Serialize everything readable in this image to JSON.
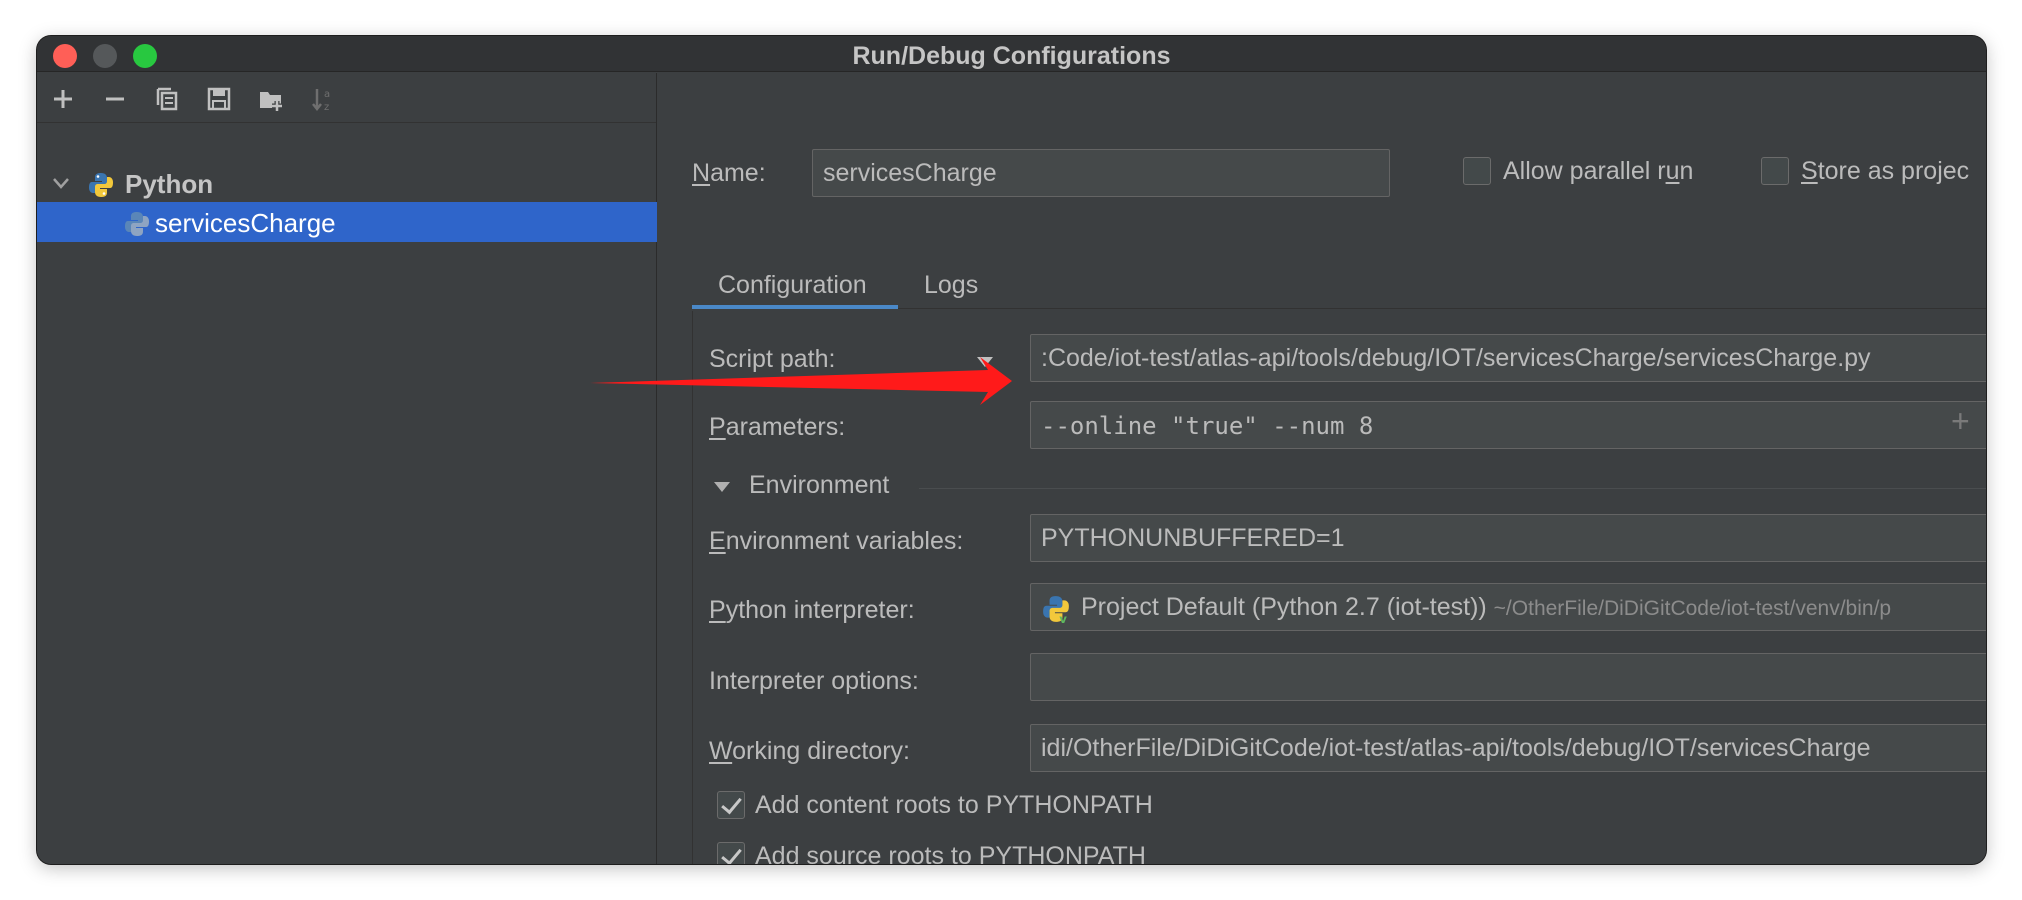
{
  "window": {
    "title": "Run/Debug Configurations"
  },
  "toolbar": {
    "icons": [
      "add-icon",
      "remove-icon",
      "copy-icon",
      "save-icon",
      "new-folder-icon",
      "sort-icon"
    ]
  },
  "tree": {
    "group_label": "Python",
    "item_label": "servicesCharge"
  },
  "form": {
    "name_label_prefix": "N",
    "name_label_rest": "ame:",
    "name_value": "servicesCharge",
    "allow_parallel_pre": "Allow parallel r",
    "allow_parallel_ul": "u",
    "allow_parallel_post": "n",
    "store_as_ul": "S",
    "store_as_rest": "tore as projec"
  },
  "tabs": [
    {
      "label": "Configuration",
      "active": true
    },
    {
      "label": "Logs",
      "active": false
    }
  ],
  "config": {
    "script_path_label": "Script path:",
    "script_path_value": ":Code/iot-test/atlas-api/tools/debug/IOT/servicesCharge/servicesCharge.py",
    "parameters_label_ul": "P",
    "parameters_label_rest": "arameters:",
    "parameters_value": "--online \"true\" --num 8",
    "environment_section": "Environment",
    "env_vars_label_ul": "E",
    "env_vars_label_rest": "nvironment variables:",
    "env_vars_value": "PYTHONUNBUFFERED=1",
    "interpreter_label_ul": "P",
    "interpreter_label_rest": "ython interpreter:",
    "interpreter_value": "Project Default (Python 2.7 (iot-test))",
    "interpreter_path": "~/OtherFile/DiDiGitCode/iot-test/venv/bin/p",
    "interp_options_label": "Interpreter options:",
    "interp_options_value": "",
    "working_dir_label_ul": "W",
    "working_dir_label_rest": "orking directory:",
    "working_dir_value": "idi/OtherFile/DiDiGitCode/iot-test/atlas-api/tools/debug/IOT/servicesCharge",
    "add_content_roots": "Add content roots to PYTHONPATH",
    "add_source_roots": "Add source roots to PYTHONPATH"
  },
  "colors": {
    "background": "#3c3f41",
    "selection": "#2f65ca",
    "tab_underline": "#4a88c7",
    "annotation_arrow": "#ff1a1a"
  }
}
